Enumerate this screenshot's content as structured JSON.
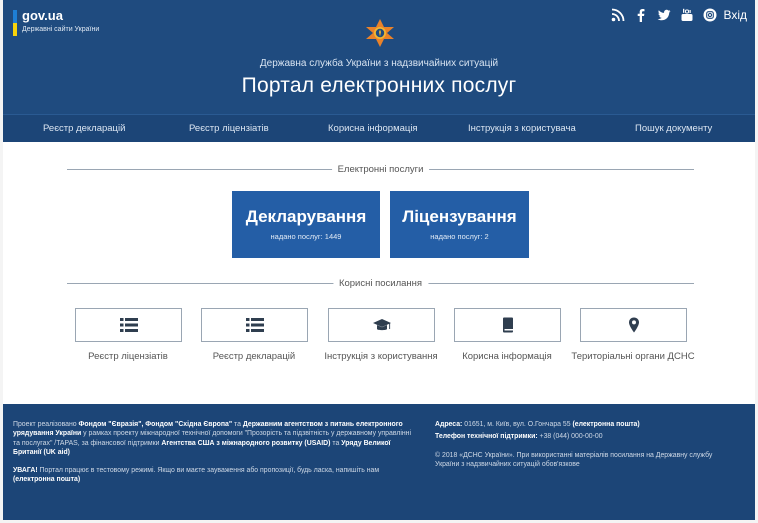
{
  "header": {
    "gov_title": "gov.ua",
    "gov_subtitle": "Державні сайти України",
    "agency": "Державна служба України з надзвичайних ситуацій",
    "portal_title": "Портал електронних послуг",
    "login_label": "Вхід",
    "social_icons": [
      "rss-icon",
      "facebook-icon",
      "twitter-icon",
      "youtube-icon",
      "instagram-icon"
    ]
  },
  "nav": {
    "items": [
      "Реєстр декларацій",
      "Реєстр ліцензіатів",
      "Корисна інформація",
      "Інструкція з користувача",
      "Пошук документу"
    ]
  },
  "services": {
    "section_label": "Електронні послуги",
    "items": [
      {
        "title": "Декларування",
        "count": "надано послуг: 1449"
      },
      {
        "title": "Ліцензування",
        "count": "надано послуг: 2"
      }
    ]
  },
  "links": {
    "section_label": "Корисні посилання",
    "items": [
      {
        "label": "Реєстр ліцензіатів",
        "icon": "list-icon"
      },
      {
        "label": "Реєстр декларацій",
        "icon": "list-icon"
      },
      {
        "label": "Інструкція з користування",
        "icon": "graduation-cap-icon"
      },
      {
        "label": "Корисна інформація",
        "icon": "book-icon"
      },
      {
        "label": "Територіальні органи ДСНС",
        "icon": "map-marker-icon"
      }
    ]
  },
  "footer": {
    "left": {
      "p1_pre": "Проект реалізовано ",
      "p1_b1": "Фондом \"Євразія\", Фондом \"Східна Європа\"",
      "p1_mid1": " та ",
      "p1_b2": "Державним агентством з питань електронного урядування України",
      "p1_mid2": " у рамках проекту міжнародної технічної допомоги \"Прозорість та підзвітність у державному управлінні та послугах\" /TAPAS, за фінансової підтримки ",
      "p1_b3": "Агентства США з міжнародного розвитку (USAID)",
      "p1_mid3": " та ",
      "p1_b4": "Уряду Великої Британії (UK aid)",
      "p2_b": "УВАГА!",
      "p2_text": " Портал працює в тестовому режимі. Якщо ви маєте зауваження або пропозиції, будь ласка, напишіть нам ",
      "p2_link": "(електронна пошта)"
    },
    "right": {
      "addr_label": "Адреса:",
      "addr_text": " 01651, м. Київ, вул. О.Гончара 55 ",
      "addr_link": "(електронна пошта)",
      "phone_label": "Телефон технічної підтримки:",
      "phone_text": " +38 (044) 000-00-00",
      "copyright": "© 2018 «ДСНС України». При використанні матеріалів посилання на Державну службу України з надзвичайних ситуацій обов'язкове"
    }
  },
  "colors": {
    "header_bg": "#1f4b7f",
    "button_bg": "#245ea6",
    "emblem_orange": "#e9822a"
  }
}
